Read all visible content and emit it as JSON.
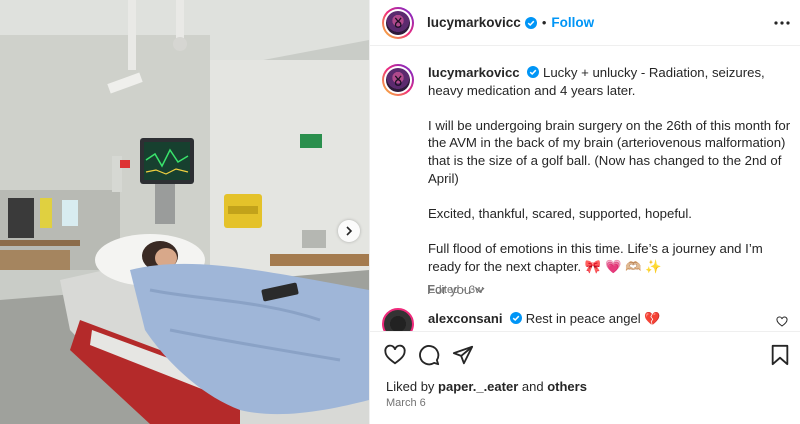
{
  "post": {
    "username": "lucymarkovicc",
    "follow_label": "Follow",
    "dot": "•",
    "caption": {
      "username": "lucymarkovicc",
      "line1": "Lucky + unlucky - Radiation, seizures, heavy medication and 4 years later.",
      "para2": "I will be undergoing brain surgery on the 26th of this month for the AVM in the back of my brain (arteriovenous malformation) that is the size of a golf ball. (Now has changed to the 2nd of April)",
      "para3": "Excited, thankful, scared, supported, hopeful.",
      "para4": "Full flood of emotions in this time. Life’s a journey and I’m ready for the next chapter. 🎀 💗 🫶🏼 ✨",
      "edited": "Edited",
      "age": "3w"
    },
    "for_you_label": "For you",
    "comment": {
      "username": "alexconsani",
      "text": "Rest in peace angel 💔"
    },
    "likes": {
      "prefix": "Liked by",
      "user": "paper._.eater",
      "and": "and",
      "others": "others"
    },
    "date": "March 6"
  },
  "icons": {
    "verified": "verified-badge-icon",
    "more": "more-options-icon",
    "like": "heart-icon",
    "comment": "comment-icon",
    "share": "share-icon",
    "save": "bookmark-icon",
    "next": "chevron-right-icon"
  },
  "colors": {
    "link_blue": "#0095f6",
    "text": "#262626",
    "secondary": "#737373",
    "verified": "#0095f6"
  }
}
